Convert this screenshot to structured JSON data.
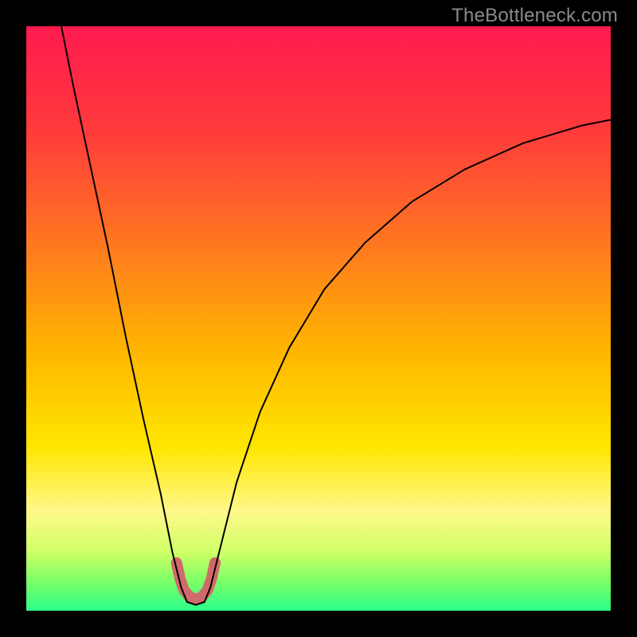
{
  "watermark": "TheBottleneck.com",
  "chart_data": {
    "type": "line",
    "title": "",
    "xlabel": "",
    "ylabel": "",
    "xlim": [
      0,
      100
    ],
    "ylim": [
      0,
      100
    ],
    "grid": false,
    "legend": false,
    "background_gradient_stops": [
      {
        "offset": 0.0,
        "color": "#ff1a4f"
      },
      {
        "offset": 0.18,
        "color": "#ff3b3b"
      },
      {
        "offset": 0.38,
        "color": "#ff7a1f"
      },
      {
        "offset": 0.55,
        "color": "#ffb400"
      },
      {
        "offset": 0.72,
        "color": "#ffe600"
      },
      {
        "offset": 0.83,
        "color": "#fff88a"
      },
      {
        "offset": 0.9,
        "color": "#cfff66"
      },
      {
        "offset": 0.95,
        "color": "#7bff66"
      },
      {
        "offset": 1.0,
        "color": "#2bff8a"
      }
    ],
    "series": [
      {
        "name": "bottleneck-curve",
        "stroke": "#000000",
        "stroke_width": 2.0,
        "points": [
          {
            "x": 6.0,
            "y": 100.0
          },
          {
            "x": 8.0,
            "y": 90.0
          },
          {
            "x": 11.0,
            "y": 76.0
          },
          {
            "x": 14.0,
            "y": 62.0
          },
          {
            "x": 17.0,
            "y": 47.0
          },
          {
            "x": 20.0,
            "y": 33.0
          },
          {
            "x": 23.0,
            "y": 20.0
          },
          {
            "x": 25.0,
            "y": 10.0
          },
          {
            "x": 26.5,
            "y": 4.0
          },
          {
            "x": 27.5,
            "y": 1.5
          },
          {
            "x": 29.0,
            "y": 1.0
          },
          {
            "x": 30.5,
            "y": 1.5
          },
          {
            "x": 31.5,
            "y": 4.0
          },
          {
            "x": 33.0,
            "y": 10.0
          },
          {
            "x": 36.0,
            "y": 22.0
          },
          {
            "x": 40.0,
            "y": 34.0
          },
          {
            "x": 45.0,
            "y": 45.0
          },
          {
            "x": 51.0,
            "y": 55.0
          },
          {
            "x": 58.0,
            "y": 63.0
          },
          {
            "x": 66.0,
            "y": 70.0
          },
          {
            "x": 75.0,
            "y": 75.5
          },
          {
            "x": 85.0,
            "y": 80.0
          },
          {
            "x": 95.0,
            "y": 83.0
          },
          {
            "x": 100.0,
            "y": 84.0
          }
        ]
      },
      {
        "name": "optimal-region-highlight",
        "stroke": "#d06a6a",
        "stroke_width": 14.0,
        "linecap": "round",
        "points": [
          {
            "x": 25.7,
            "y": 8.2
          },
          {
            "x": 26.3,
            "y": 5.5
          },
          {
            "x": 27.0,
            "y": 3.5
          },
          {
            "x": 28.0,
            "y": 2.3
          },
          {
            "x": 29.0,
            "y": 2.0
          },
          {
            "x": 30.0,
            "y": 2.3
          },
          {
            "x": 31.0,
            "y": 3.5
          },
          {
            "x": 31.7,
            "y": 5.5
          },
          {
            "x": 32.3,
            "y": 8.2
          }
        ]
      }
    ]
  }
}
